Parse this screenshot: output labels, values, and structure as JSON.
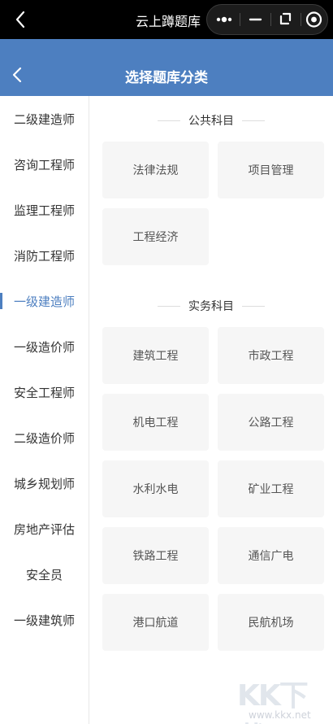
{
  "window": {
    "app_title": "云上蹲题库"
  },
  "header": {
    "title": "选择题库分类"
  },
  "sidebar": {
    "items": [
      {
        "label": "二级建造师"
      },
      {
        "label": "咨询工程师"
      },
      {
        "label": "监理工程师"
      },
      {
        "label": "消防工程师"
      },
      {
        "label": "一级建造师",
        "active": true
      },
      {
        "label": "一级造价师"
      },
      {
        "label": "安全工程师"
      },
      {
        "label": "二级造价师"
      },
      {
        "label": "城乡规划师"
      },
      {
        "label": "房地产评估"
      },
      {
        "label": "安全员"
      },
      {
        "label": "一级建筑师"
      }
    ]
  },
  "sections": [
    {
      "title": "公共科目",
      "cards": [
        "法律法规",
        "项目管理",
        "工程经济"
      ]
    },
    {
      "title": "实务科目",
      "cards": [
        "建筑工程",
        "市政工程",
        "机电工程",
        "公路工程",
        "水利水电",
        "矿业工程",
        "铁路工程",
        "通信广电",
        "港口航道",
        "民航机场"
      ]
    }
  ],
  "watermark": {
    "logo": "KK下载",
    "url": "www.kkx.net"
  },
  "colors": {
    "header_bg": "#4d7fc0",
    "accent": "#4d7fc0",
    "topbar_bg": "#000000",
    "card_bg": "#f6f6f6"
  }
}
